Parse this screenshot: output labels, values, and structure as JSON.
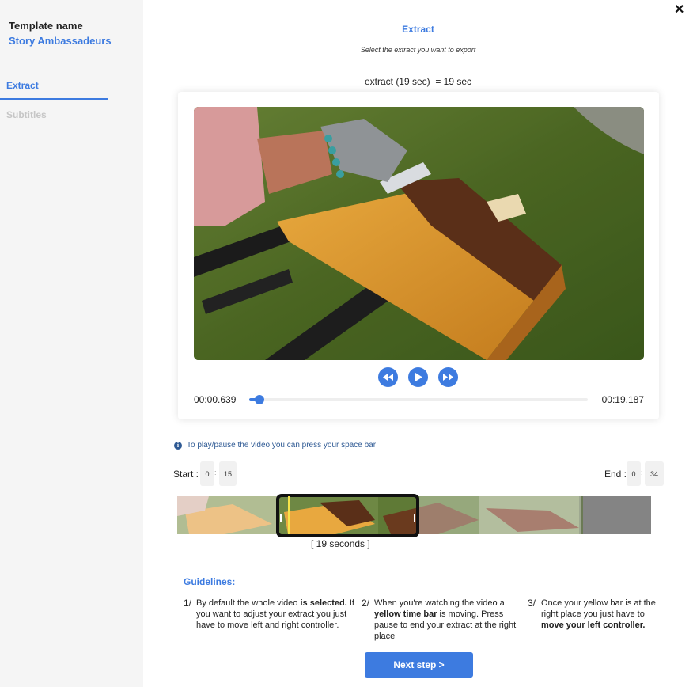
{
  "sidebar": {
    "template_label": "Template name",
    "template_value": "Story Ambassadeurs",
    "tabs": [
      {
        "label": "Extract",
        "active": true
      },
      {
        "label": "Subtitles",
        "active": false
      }
    ]
  },
  "close_icon": "close-icon",
  "header": {
    "title": "Extract",
    "subtitle": "Select the extract you want to export",
    "duration": "extract (19 sec)  = 19 sec"
  },
  "player": {
    "current_time": "00:00.639",
    "end_time": "00:19.187",
    "progress_fraction": 0.03,
    "controls": [
      "rewind-icon",
      "play-icon",
      "fast-forward-icon"
    ]
  },
  "info_text": "To play/pause the video you can press your space bar",
  "range": {
    "start_label": "Start :",
    "start_min": "0",
    "start_sec": "15",
    "end_label": "End :",
    "end_min": "0",
    "end_sec": "34",
    "separator": ":"
  },
  "timeline": {
    "selection_label": "[ 19 seconds ]"
  },
  "guidelines": {
    "title": "Guidelines:",
    "items": [
      {
        "num": "1/",
        "pre": "By default the whole video ",
        "bold": "is selected.",
        "post": " If you want to adjust your extract you just have to move left and right controller."
      },
      {
        "num": "2/",
        "pre": "When you're watching the video a ",
        "bold": "yellow time bar",
        "post": " is moving. Press pause to end your extract at the right place"
      },
      {
        "num": "3/",
        "pre": "Once your yellow bar is at the right place you just have to ",
        "bold": "move your left controller.",
        "post": ""
      }
    ]
  },
  "next_button": "Next step >",
  "colors": {
    "accent": "#3d7be0",
    "sidebar_bg": "#f5f5f5",
    "playhead": "#f6e34a"
  }
}
